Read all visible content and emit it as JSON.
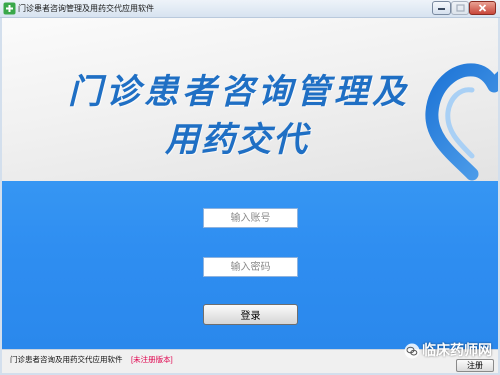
{
  "window": {
    "title": "门诊患者咨询管理及用药交代应用软件",
    "icon": "app-icon",
    "controls": {
      "minimize": "minimize-icon",
      "maximize": "maximize-icon",
      "close": "close-icon"
    }
  },
  "banner": {
    "line1": "门诊患者咨询管理及",
    "line2": "用药交代",
    "logo": "heart-ribbon-logo-icon",
    "text_color": "#1f6fc4"
  },
  "login": {
    "username_placeholder": "输入账号",
    "password_placeholder": "输入密码",
    "submit_label": "登录",
    "panel_color": "#2f8ef1"
  },
  "status_bar": {
    "app_name": "门诊患者咨询及用药交代应用软件",
    "version_note": "[未注册版本]",
    "version_note_color": "#e0004c",
    "register_label": "注册"
  },
  "watermark": {
    "icon": "wechat-icon",
    "text": "临床药师网"
  }
}
